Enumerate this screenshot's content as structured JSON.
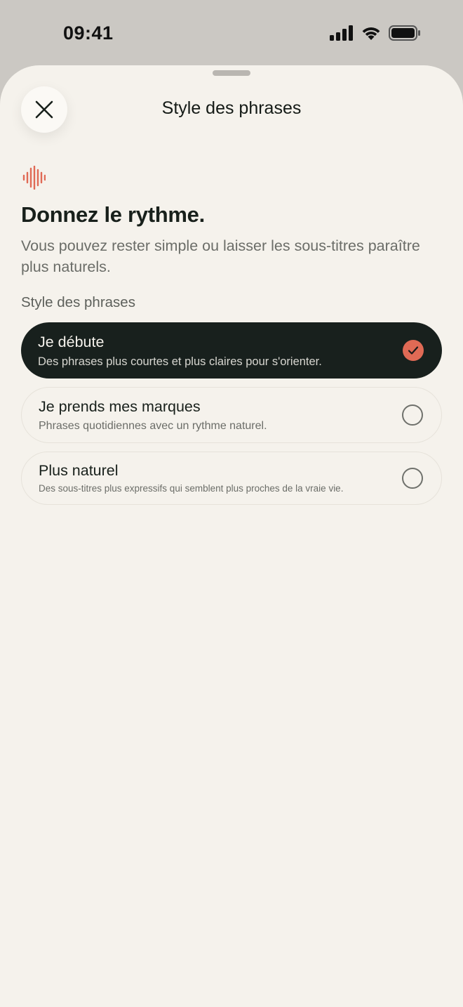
{
  "status_bar": {
    "time": "09:41",
    "icons": [
      "cellular-signal-icon",
      "wifi-icon",
      "battery-icon"
    ]
  },
  "sheet": {
    "title": "Style des phrases",
    "close_icon": "close-icon"
  },
  "content": {
    "icon": "sound-wave-icon",
    "headline": "Donnez le rythme.",
    "subline": "Vous pouvez rester simple ou laisser les sous-titres paraître plus naturels.",
    "section_label": "Style des phrases",
    "options": [
      {
        "title": "Je débute",
        "description": "Des phrases plus courtes et plus claires pour s'orienter.",
        "selected": true
      },
      {
        "title": "Je prends mes marques",
        "description": "Phrases quotidiennes avec un rythme naturel.",
        "selected": false
      },
      {
        "title": "Plus naturel",
        "description": "Des sous-titres plus expressifs qui semblent plus proches de la vraie vie.",
        "selected": false
      }
    ]
  },
  "colors": {
    "background": "#f5f2ec",
    "accent": "#e06a55",
    "selected_bg": "#18201d"
  }
}
